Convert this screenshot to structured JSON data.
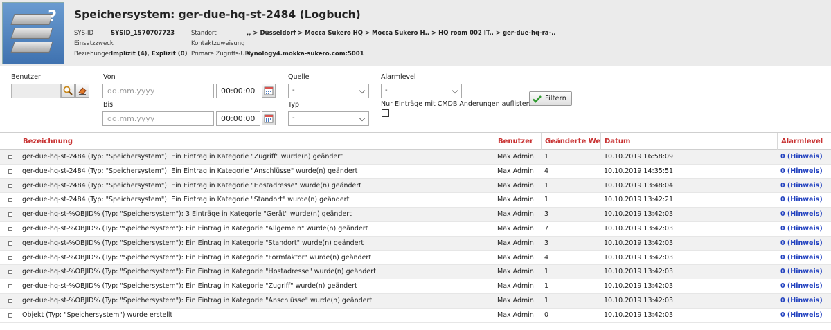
{
  "header": {
    "title": "Speichersystem: ger-due-hq-st-2484 (Logbuch)",
    "sysid_label": "SYS-ID",
    "sysid_value": "SYSID_1570707723",
    "einsatzzweck_label": "Einsatzzweck",
    "beziehungen_label": "Beziehungen",
    "beziehungen_value": "Implizit (4), Explizit (0)",
    "standort_label": "Standort",
    "standort_value": ",, > Düsseldorf > Mocca Sukero HQ > Mocca Sukero H.. > HQ room 002 IT.. > ger-due-hq-ra-..",
    "kontakt_label": "Kontaktzuweisung",
    "url_label": "Primäre Zugriffs-URL",
    "url_value": "synology4.mokka-sukero.com:5001"
  },
  "filter": {
    "benutzer_label": "Benutzer",
    "von_label": "Von",
    "bis_label": "Bis",
    "date_placeholder": "dd.mm.yyyy",
    "time_value": "00:00:00",
    "quelle_label": "Quelle",
    "quelle_value": "-",
    "typ_label": "Typ",
    "typ_value": "-",
    "alarmlevel_label": "Alarmlevel",
    "alarmlevel_value": "-",
    "cmdb_label": "Nur Einträge mit CMDB Änderungen auflisten",
    "filter_button": "Filtern"
  },
  "table": {
    "columns": [
      "Bezeichnung",
      "Benutzer",
      "Geänderte We...",
      "Datum",
      "Alarmlevel"
    ],
    "rows": [
      {
        "bezeichnung": "ger-due-hq-st-2484 (Typ: \"Speichersystem\"): Ein Eintrag in Kategorie \"Zugriff\" wurde(n) geändert",
        "benutzer": "Max Admin",
        "geaendert": "1",
        "datum": "10.10.2019 16:58:09",
        "alarm": "0 (Hinweis)"
      },
      {
        "bezeichnung": "ger-due-hq-st-2484 (Typ: \"Speichersystem\"): Ein Eintrag in Kategorie \"Anschlüsse\" wurde(n) geändert",
        "benutzer": "Max Admin",
        "geaendert": "4",
        "datum": "10.10.2019 14:35:51",
        "alarm": "0 (Hinweis)"
      },
      {
        "bezeichnung": "ger-due-hq-st-2484 (Typ: \"Speichersystem\"): Ein Eintrag in Kategorie \"Hostadresse\" wurde(n) geändert",
        "benutzer": "Max Admin",
        "geaendert": "1",
        "datum": "10.10.2019 13:48:04",
        "alarm": "0 (Hinweis)"
      },
      {
        "bezeichnung": "ger-due-hq-st-2484 (Typ: \"Speichersystem\"): Ein Eintrag in Kategorie \"Standort\" wurde(n) geändert",
        "benutzer": "Max Admin",
        "geaendert": "1",
        "datum": "10.10.2019 13:42:21",
        "alarm": "0 (Hinweis)"
      },
      {
        "bezeichnung": "ger-due-hq-st-%OBJID% (Typ: \"Speichersystem\"): 3 Einträge in Kategorie \"Gerät\" wurde(n) geändert",
        "benutzer": "Max Admin",
        "geaendert": "3",
        "datum": "10.10.2019 13:42:03",
        "alarm": "0 (Hinweis)"
      },
      {
        "bezeichnung": "ger-due-hq-st-%OBJID% (Typ: \"Speichersystem\"): Ein Eintrag in Kategorie \"Allgemein\" wurde(n) geändert",
        "benutzer": "Max Admin",
        "geaendert": "7",
        "datum": "10.10.2019 13:42:03",
        "alarm": "0 (Hinweis)"
      },
      {
        "bezeichnung": "ger-due-hq-st-%OBJID% (Typ: \"Speichersystem\"): Ein Eintrag in Kategorie \"Standort\" wurde(n) geändert",
        "benutzer": "Max Admin",
        "geaendert": "3",
        "datum": "10.10.2019 13:42:03",
        "alarm": "0 (Hinweis)"
      },
      {
        "bezeichnung": "ger-due-hq-st-%OBJID% (Typ: \"Speichersystem\"): Ein Eintrag in Kategorie \"Formfaktor\" wurde(n) geändert",
        "benutzer": "Max Admin",
        "geaendert": "4",
        "datum": "10.10.2019 13:42:03",
        "alarm": "0 (Hinweis)"
      },
      {
        "bezeichnung": "ger-due-hq-st-%OBJID% (Typ: \"Speichersystem\"): Ein Eintrag in Kategorie \"Hostadresse\" wurde(n) geändert",
        "benutzer": "Max Admin",
        "geaendert": "1",
        "datum": "10.10.2019 13:42:03",
        "alarm": "0 (Hinweis)"
      },
      {
        "bezeichnung": "ger-due-hq-st-%OBJID% (Typ: \"Speichersystem\"): Ein Eintrag in Kategorie \"Zugriff\" wurde(n) geändert",
        "benutzer": "Max Admin",
        "geaendert": "1",
        "datum": "10.10.2019 13:42:03",
        "alarm": "0 (Hinweis)"
      },
      {
        "bezeichnung": "ger-due-hq-st-%OBJID% (Typ: \"Speichersystem\"): Ein Eintrag in Kategorie \"Anschlüsse\" wurde(n) geändert",
        "benutzer": "Max Admin",
        "geaendert": "1",
        "datum": "10.10.2019 13:42:03",
        "alarm": "0 (Hinweis)"
      },
      {
        "bezeichnung": "Objekt (Typ: \"Speichersystem\") wurde erstellt",
        "benutzer": "Max Admin",
        "geaendert": "0",
        "datum": "10.10.2019 13:42:03",
        "alarm": "0 (Hinweis)"
      }
    ]
  },
  "icons": {
    "logo": "storage-system-icon",
    "search": "search-icon",
    "clear": "eraser-icon",
    "calendar": "calendar-icon",
    "filter_check": "checkmark-icon"
  },
  "colors": {
    "header_text": "#c83232",
    "link": "#1f3fbf",
    "row_alt": "#f1f1f1"
  }
}
